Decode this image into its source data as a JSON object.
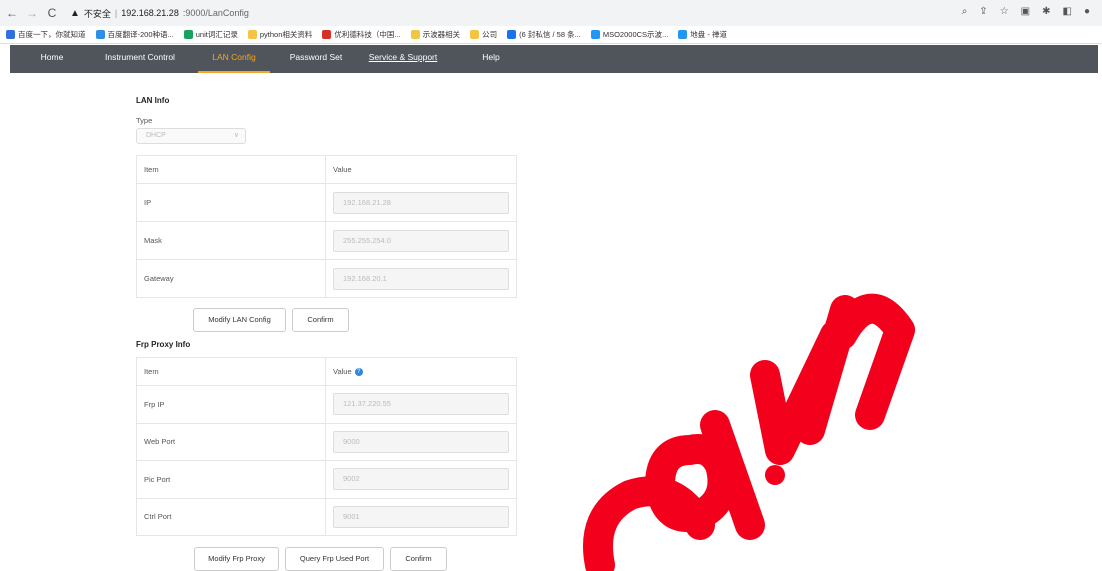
{
  "browser": {
    "url_warning": "不安全",
    "url_host": "192.168.21.28",
    "url_path": ":9000/LanConfig"
  },
  "bookmarks": [
    {
      "label": "百度一下，你就知道",
      "color": "#2f6fe4"
    },
    {
      "label": "百度翻译-200种语...",
      "color": "#2f8fe4"
    },
    {
      "label": "unit词汇记录",
      "color": "#1aa260"
    },
    {
      "label": "python相关资料",
      "color": "#f4c542"
    },
    {
      "label": "优利德科技（中国...",
      "color": "#d93025"
    },
    {
      "label": "示波器相关",
      "color": "#f4c542"
    },
    {
      "label": "公司",
      "color": "#f4c542"
    },
    {
      "label": "(6 封私信 / 58 条...",
      "color": "#1a73e8"
    },
    {
      "label": "MSO2000CS示波...",
      "color": "#2196f3"
    },
    {
      "label": "地盘 - 禅道",
      "color": "#2196f3"
    }
  ],
  "nav": {
    "home": "Home",
    "instrument_control": "Instrument Control",
    "lan_config": "LAN Config",
    "password_set": "Password Set",
    "service_support": "Service & Support",
    "help": "Help"
  },
  "lan": {
    "title": "LAN Info",
    "type_label": "Type",
    "type_value": "DHCP",
    "col_item": "Item",
    "col_value": "Value",
    "rows": [
      {
        "item": "IP",
        "value": "192.168.21.28"
      },
      {
        "item": "Mask",
        "value": "255.255.254.0"
      },
      {
        "item": "Gateway",
        "value": "192.168.20.1"
      }
    ],
    "modify_button": "Modify LAN Config",
    "confirm_button": "Confirm"
  },
  "frp": {
    "title": "Frp Proxy Info",
    "col_item": "Item",
    "col_value": "Value",
    "rows": [
      {
        "item": "Frp IP",
        "value": "121.37.220.55"
      },
      {
        "item": "Web Port",
        "value": "9000"
      },
      {
        "item": "Pic Port",
        "value": "9002"
      },
      {
        "item": "Ctrl Port",
        "value": "9001"
      }
    ],
    "modify_button": "Modify Frp Proxy",
    "query_button": "Query Frp Used Port",
    "confirm_button": "Confirm"
  }
}
